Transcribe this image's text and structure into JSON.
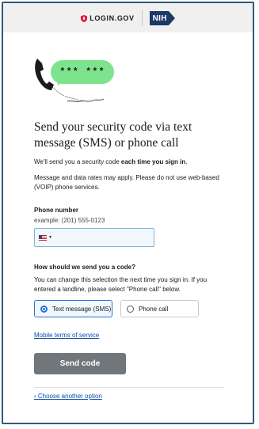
{
  "header": {
    "login_brand": "LOGIN.GOV",
    "partner_brand": "NIH"
  },
  "hero": {
    "bubble_text": "*** ***",
    "icon": "phone-sms-icon",
    "bubble_color": "#7ee38e"
  },
  "main": {
    "title": "Send your security code via text message (SMS) or phone call",
    "intro_prefix": "We'll send you a security code ",
    "intro_bold": "each time you sign in",
    "intro_suffix": ".",
    "rates_notice": "Message and data rates may apply. Please do not use web-based (VOIP) phone services.",
    "phone": {
      "label": "Phone number",
      "hint": "example: (201) 555-0123",
      "country": "United States",
      "value": ""
    },
    "delivery": {
      "question": "How should we send you a code?",
      "help": "You can change this selection the next time you sign in. If you entered a landline, please select \"Phone call\" below.",
      "options": [
        {
          "label": "Text message (SMS)",
          "selected": true
        },
        {
          "label": "Phone call",
          "selected": false
        }
      ]
    },
    "terms_link": "Mobile terms of service",
    "submit_label": "Send code",
    "back_link": "‹ Choose another option"
  },
  "colors": {
    "accent": "#2672de",
    "button_disabled": "#71767a",
    "link": "#0a4fa8",
    "brand_red": "#e21c3d",
    "nih_blue": "#1b3a66"
  }
}
